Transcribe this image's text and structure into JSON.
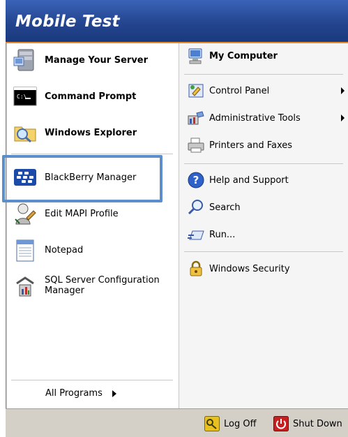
{
  "header": {
    "title": "Mobile Test"
  },
  "left_items": [
    {
      "label": "Manage Your Server"
    },
    {
      "label": "Command Prompt",
      "icon_text": "C:\\"
    },
    {
      "label": "Windows Explorer"
    },
    {
      "label": "BlackBerry Manager"
    },
    {
      "label": "Edit MAPI Profile"
    },
    {
      "label": "Notepad"
    },
    {
      "label": "SQL Server Configuration",
      "label2": "Manager"
    }
  ],
  "all_programs": {
    "label": "All Programs"
  },
  "right_items": [
    {
      "label": "My Computer"
    },
    {
      "label": "Control Panel"
    },
    {
      "label": "Administrative Tools"
    },
    {
      "label": "Printers and Faxes"
    },
    {
      "label": "Help and Support"
    },
    {
      "label": "Search"
    },
    {
      "label": "Run..."
    },
    {
      "label": "Windows Security"
    }
  ],
  "bottom": {
    "log_off": "Log Off",
    "shut_down": "Shut Down"
  },
  "colors": {
    "title_bar": "#24458f",
    "title_accent": "#e58a2e",
    "highlight_box": "#5b8ecb",
    "right_pane": "#f5f5f5",
    "frame": "#d4d0c8"
  }
}
